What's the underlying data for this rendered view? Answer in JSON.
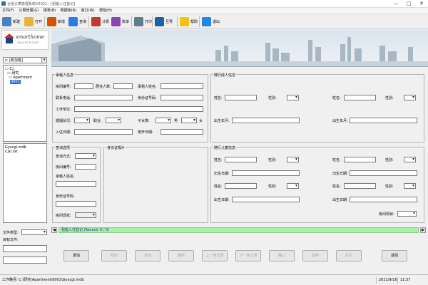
{
  "window": {
    "title": "合租公寓管理系统V2021 - [租客入住登记]",
    "buttons": {
      "minimize": "—",
      "maximize": "□",
      "close": "✕"
    }
  },
  "menu": [
    "文件(F)",
    "公寓管理(G)",
    "报表(B)",
    "数据库(R)",
    "窗口(W)",
    "帮助(H)"
  ],
  "toolbar": [
    {
      "label": "新建",
      "icon": "new-doc-icon",
      "color": "#4a7fc1"
    },
    {
      "label": "打开",
      "icon": "open-folder-icon",
      "color": "#e8b33a"
    },
    {
      "label": "新增",
      "icon": "add-person-icon",
      "color": "#d35400"
    },
    {
      "label": "查询",
      "icon": "magnifier-icon",
      "color": "#2c7be5"
    },
    {
      "label": "计费",
      "icon": "calculator-icon",
      "color": "#c0392b"
    },
    {
      "label": "账单",
      "icon": "bar-chart-icon",
      "color": "#8e44ad"
    },
    {
      "label": "打印",
      "icon": "printer-icon",
      "color": "#607d8b"
    },
    {
      "label": "互导",
      "icon": "book-icon",
      "color": "#1f5fa8"
    },
    {
      "label": "帮助",
      "icon": "help-icon",
      "color": "#f1c40f"
    },
    {
      "label": "退出",
      "icon": "exit-icon",
      "color": "#1e88e5"
    }
  ],
  "logo": {
    "name": "smarthome",
    "sub": "SMARTHOME"
  },
  "left": {
    "drive": "c: [新加卷]",
    "tree": [
      "C:\\",
      "研究",
      "Apartment",
      "0001"
    ],
    "files": [
      "Gyxcgl.mdb",
      "Cjxl.txt"
    ],
    "file_type_label": "文件类型:",
    "target_file_label": "目标文件:"
  },
  "tenant": {
    "title": "承租人信息",
    "room_no": "房间编号:",
    "living_count": "居住人数:",
    "name": "承租人姓名:",
    "phone": "联系电话:",
    "id_no": "身份证号码:",
    "workplace": "工作单位:",
    "marital": "婚姻状况:",
    "job": "职业:",
    "children": "子女数:",
    "male": "男",
    "female": "女",
    "checkin": "入住日期:",
    "leave": "离开日期:"
  },
  "query": {
    "title": "查询选项",
    "method": "查询方式:",
    "room_no": "房间编号:",
    "name": "承租人姓名:",
    "id_no": "身份证号码:",
    "room_status": "房间现状:"
  },
  "idphoto": {
    "title": "身份证相片"
  },
  "adults": {
    "title": "随行成人信息",
    "name": "姓名:",
    "gender": "性别:",
    "birth": "出生年月:"
  },
  "children": {
    "title": "随行儿童信息",
    "name": "姓名:",
    "gender": "性别:",
    "birth": "出生日期:",
    "room_status": "房间现状:"
  },
  "nav": {
    "record": "租客入住登记 (Record: 0 / 0)"
  },
  "buttons": [
    "添加",
    "修改",
    "查询",
    "删除",
    "上一条记录",
    "下一条记录",
    "确认",
    "放弃",
    "打印",
    "返回"
  ],
  "status": {
    "path": "工作路径: C:\\研究\\Apartment\\0001\\Gyxcgl.mdb",
    "date": "2021/9/16",
    "time": "11:37"
  }
}
